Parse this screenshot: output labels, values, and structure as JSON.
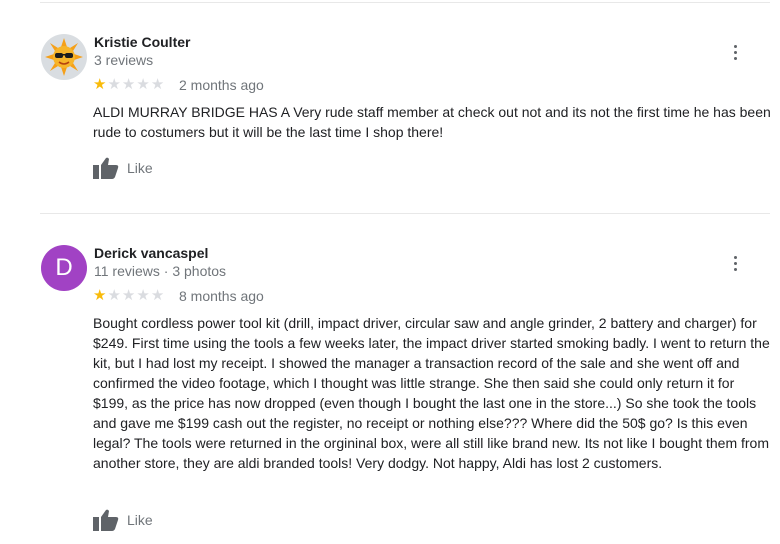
{
  "reviews": [
    {
      "author": "Kristie Coulter",
      "meta": "3 reviews",
      "rating": 1,
      "date": "2 months ago",
      "text": "ALDI MURRAY BRIDGE HAS A Very rude staff member at check out not and its not the first time he has been rude to costumers but it will be the last time I shop there!",
      "like_label": "Like",
      "avatar_icon": "sun-with-sunglasses"
    },
    {
      "author": "Derick vancaspel",
      "meta": "11 reviews · 3 photos",
      "rating": 1,
      "date": "8 months ago",
      "text": "Bought cordless power tool kit (drill, impact driver, circular saw and angle grinder, 2 battery and charger) for $249. First time using the tools a few weeks later, the impact driver started smoking badly. I went to return the kit, but I had lost my receipt. I showed the manager a transaction record of the sale and she went off and confirmed the video footage, which I thought was little strange. She then said she could only return it for $199, as the price has now dropped (even though I bought the last one in the store...) So she took the tools and gave me  $199 cash out the register, no receipt or nothing else???  Where did the 50$ go? Is this even legal? The tools were returned in the orgininal box, were all still like brand new. Its not like I bought them from another store, they are aldi branded tools! Very dodgy. Not happy, Aldi has lost 2 customers.",
      "like_label": "Like",
      "avatar_letter": "D",
      "avatar_color": "#a142c4"
    }
  ],
  "colors": {
    "star_filled": "#f9bb0a",
    "star_empty": "#dadce0"
  }
}
